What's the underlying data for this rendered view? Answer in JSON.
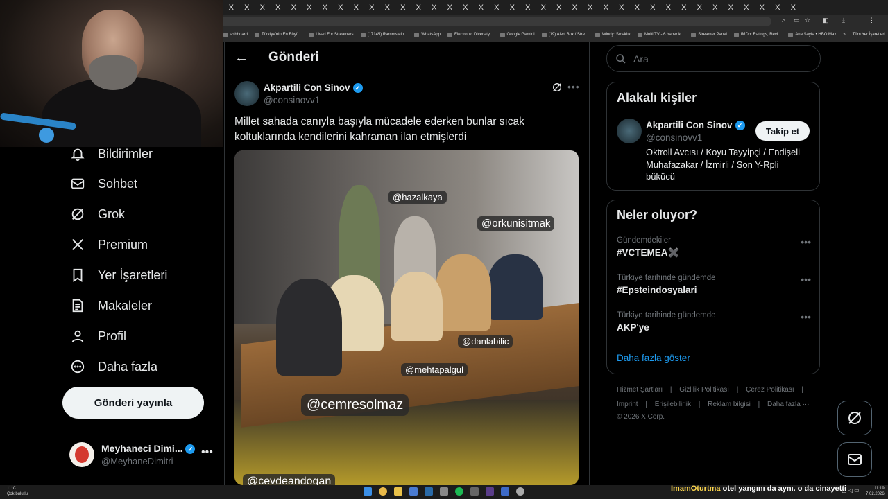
{
  "browser": {
    "tab_close_glyph": "X",
    "tab_count": 37,
    "bookmarks": [
      "ashboard",
      "Türkiye'nin En Büyü...",
      "Livad For Streamers",
      "(17145) Rammstein...",
      "WhatsApp",
      "Electronic Diversity...",
      "Google Gemini",
      "(19) Alert Box / Stre...",
      "Windy: Sıcaklık",
      "Multi TV - 6 haber k...",
      "Streamer Panel",
      "IMDb: Ratings, Revi...",
      "Ana Sayfa • HBO Max"
    ],
    "bookmarks_overflow": "»",
    "all_bookmarks": "Tüm Yer İşaretleri"
  },
  "nav": {
    "items": [
      {
        "label": "Bildirimler",
        "icon": "bell-icon"
      },
      {
        "label": "Sohbet",
        "icon": "mail-icon"
      },
      {
        "label": "Grok",
        "icon": "grok-icon"
      },
      {
        "label": "Premium",
        "icon": "x-logo-icon"
      },
      {
        "label": "Yer İşaretleri",
        "icon": "bookmark-icon"
      },
      {
        "label": "Makaleler",
        "icon": "article-icon"
      },
      {
        "label": "Profil",
        "icon": "person-icon"
      },
      {
        "label": "Daha fazla",
        "icon": "more-circle-icon"
      }
    ],
    "post_button": "Gönderi yayınla",
    "account": {
      "name": "Meyhaneci Dimi...",
      "handle": "@MeyhaneDimitri",
      "more": "•••"
    }
  },
  "main": {
    "back_glyph": "←",
    "title": "Gönderi",
    "tweet": {
      "author_name": "Akpartili Con Sinov",
      "author_handle": "@consinovv1",
      "more": "•••",
      "text": "Millet sahada canıyla başıyla mücadele ederken bunlar sıcak koltuklarında kendilerini kahraman ilan etmişlerdi",
      "photo_tags": [
        "@hazalkaya",
        "@orkunisitmak",
        "@danlabilic",
        "@mehtapalgul",
        "@cemresolmaz",
        "@cevdeandogan"
      ]
    }
  },
  "search": {
    "placeholder": "Ara"
  },
  "related": {
    "heading": "Alakalı kişiler",
    "name": "Akpartili Con Sinov",
    "handle": "@consinovv1",
    "follow_label": "Takip et",
    "bio": "Oktroll Avcısı / Koyu Tayyipçi / Endişeli Muhafazakar / İzmirli / Son Y-Rpli bükücü"
  },
  "trends": {
    "heading": "Neler oluyor?",
    "items": [
      {
        "context": "Gündemdekiler",
        "title": "#VCTEMEA✖️"
      },
      {
        "context": "Türkiye tarihinde gündemde",
        "title": "#Epsteindosyalari"
      },
      {
        "context": "Türkiye tarihinde gündemde",
        "title": "AKP'ye"
      }
    ],
    "more": "•••",
    "show_more": "Daha fazla göster"
  },
  "footer": {
    "links_row1": [
      "Hizmet Şartları",
      "Gizlilik Politikası",
      "Çerez Politikası"
    ],
    "links_row2": [
      "Imprint",
      "Erişilebilirlik",
      "Reklam bilgisi",
      "Daha fazla ···"
    ],
    "separator": "|",
    "copyright": "© 2026 X Corp."
  },
  "taskbar": {
    "weather_temp": "11°C",
    "weather_desc": "Çok bulutlu",
    "ticker_user": "ImamOturtma",
    "ticker_text": "otel yangını da aynı. o da cinayetti",
    "time": "11:19",
    "date": "7.02.2026"
  },
  "colors": {
    "accent": "#1d9bf0",
    "background": "#000000",
    "border": "#2f3336",
    "muted": "#71767b"
  }
}
